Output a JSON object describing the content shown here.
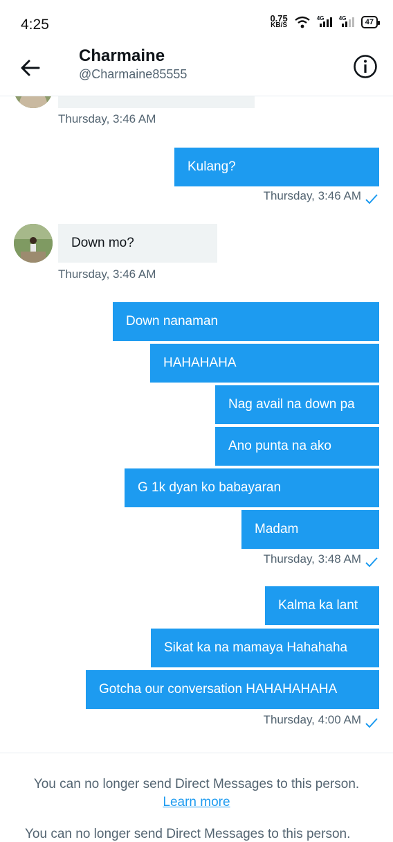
{
  "status_bar": {
    "time": "4:25",
    "speed_value": "0.75",
    "speed_unit": "KB/S",
    "net1": "4G",
    "net2": "4G",
    "battery": "47"
  },
  "header": {
    "name": "Charmaine",
    "handle": "@Charmaine85555",
    "back_icon": "arrow-left-icon",
    "info_icon": "info-icon"
  },
  "thread": {
    "ts1": "Thursday, 3:46 AM",
    "m_kulang": "Kulang?",
    "ts2": "Thursday, 3:46 AM",
    "m_down_mo": "Down mo?",
    "ts3": "Thursday, 3:46 AM",
    "m1": "Down nanaman",
    "m2": "HAHAHAHA",
    "m3": "Nag avail na down pa",
    "m4": "Ano punta na ako",
    "m5": "G 1k dyan ko babayaran",
    "m6": "Madam",
    "ts4": "Thursday, 3:48 AM",
    "m7": "Kalma ka lant",
    "m8": "Sikat ka na mamaya Hahahaha",
    "m9": "Gotcha our conversation HAHAHAHAHA",
    "ts5": "Thursday, 4:00 AM"
  },
  "footer": {
    "notice": "You can no longer send Direct Messages to this person.",
    "learn_more": "Learn more",
    "cutoff_text": "You can no longer send Direct Messages to this person."
  },
  "colors": {
    "accent": "#1d9bf0",
    "incoming_bg": "#eff3f4",
    "muted": "#536471"
  }
}
